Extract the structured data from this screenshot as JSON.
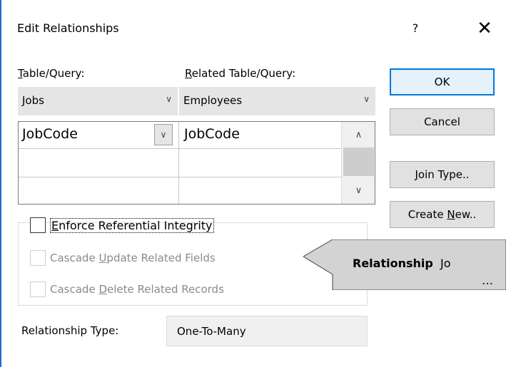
{
  "window": {
    "title": "Edit Relationships",
    "help_label": "?",
    "close_label": "✕"
  },
  "left": {
    "table_label_first": "T",
    "table_label_rest": "able/Query:",
    "related_label_first": "R",
    "related_label_rest": "elated Table/Query:",
    "table_value": "Jobs",
    "related_value": "Employees"
  },
  "grid": {
    "rows": [
      {
        "left": "JobCode",
        "right": "JobCode"
      },
      {
        "left": "",
        "right": ""
      },
      {
        "left": "",
        "right": ""
      }
    ],
    "dropdown_glyph": "∨",
    "scroll_up_glyph": "∧",
    "scroll_down_glyph": "∨"
  },
  "options": {
    "enforce_first": "E",
    "enforce_rest": "nforce Referential Integrity",
    "cascade_update_pre": "Cascade ",
    "cascade_update_ul": "U",
    "cascade_update_post": "pdate Related Fields",
    "cascade_delete_pre": "Cascade ",
    "cascade_delete_ul": "D",
    "cascade_delete_post": "elete Related Records",
    "enforce_checked": false,
    "cascade_update_checked": false,
    "cascade_delete_checked": false
  },
  "relationship_type": {
    "label": "Relationship Type:",
    "value": "One-To-Many"
  },
  "buttons": {
    "ok": "OK",
    "cancel": "Cancel",
    "join_type_ul": "J",
    "join_type_rest": "oin Type..",
    "create_new_pre": "Create ",
    "create_new_ul": "N",
    "create_new_post": "ew.."
  },
  "tooltip": {
    "bold": "Relationship",
    "rest": "Jo",
    "line2": "…"
  },
  "colors": {
    "accent": "#0078d7",
    "tooltip_bg": "#d3d3d3"
  }
}
